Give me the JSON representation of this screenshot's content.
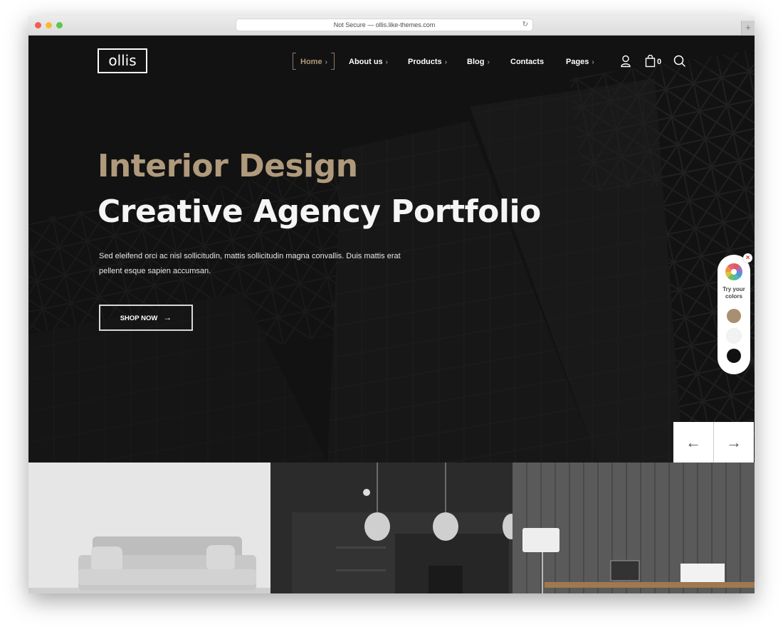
{
  "browser": {
    "url_text": "Not Secure — ollis.like-themes.com",
    "reload_icon": "reload-icon",
    "new_tab_icon": "plus-icon"
  },
  "header": {
    "logo": "ollis",
    "nav": [
      {
        "label": "Home",
        "active": true,
        "has_submenu": true
      },
      {
        "label": "About us",
        "active": false,
        "has_submenu": true
      },
      {
        "label": "Products",
        "active": false,
        "has_submenu": true
      },
      {
        "label": "Blog",
        "active": false,
        "has_submenu": true
      },
      {
        "label": "Contacts",
        "active": false,
        "has_submenu": false
      },
      {
        "label": "Pages",
        "active": false,
        "has_submenu": true
      }
    ],
    "chevron": "›",
    "cart_count": "0",
    "icons": [
      "user-icon",
      "shopping-bag-icon",
      "search-icon"
    ]
  },
  "hero": {
    "title_line1": "Interior Design",
    "title_line2": "Creative Agency Portfolio",
    "description": "Sed eleifend orci ac nisl sollicitudin, mattis sollicitudin magna convallis. Duis mattis erat pellent esque sapien accumsan.",
    "cta_label": "SHOP NOW",
    "cta_arrow": "→"
  },
  "color_picker": {
    "close": "×",
    "label": "Try your colors",
    "swatches": [
      "#a88f72",
      "#f2f2f2",
      "#111111"
    ]
  },
  "slider": {
    "prev": "←",
    "next": "→"
  },
  "colors": {
    "accent": "#b09a7c",
    "background": "#181818"
  },
  "gallery": [
    {
      "name": "living-room-sofa"
    },
    {
      "name": "dark-kitchen-pendants"
    },
    {
      "name": "office-desk-lamp"
    }
  ]
}
